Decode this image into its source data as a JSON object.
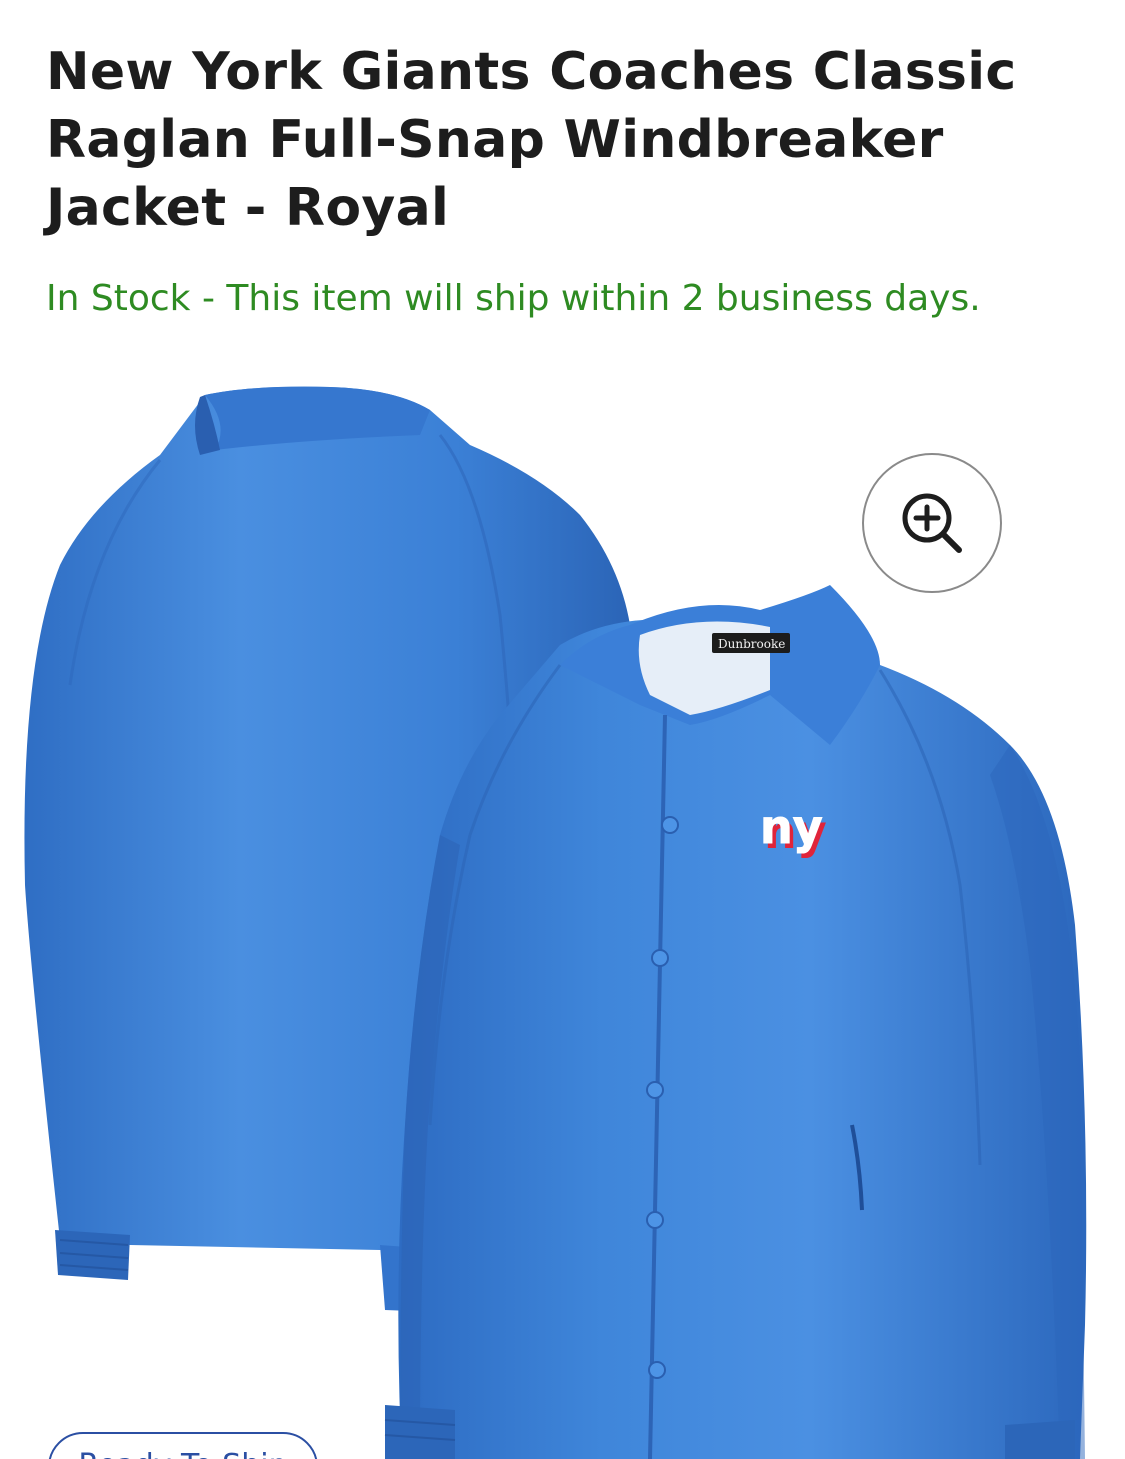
{
  "product": {
    "title": "New York Giants Coaches Classic Raglan Full-Snap Windbreaker Jacket - Royal",
    "stock_status": "In Stock - This item will ship within 2 business days."
  },
  "gallery": {
    "zoom_icon": "zoom-in-icon",
    "logo_text": "ny",
    "tag_text": "Dunbrooke",
    "colors": {
      "jacket": "#3a7fd6",
      "jacket_shadow": "#2a63b5",
      "jacket_highlight": "#5a9be6",
      "logo_red": "#e0243a",
      "stock_green": "#2e8b22"
    }
  },
  "badge": {
    "label": "Ready To Ship"
  }
}
